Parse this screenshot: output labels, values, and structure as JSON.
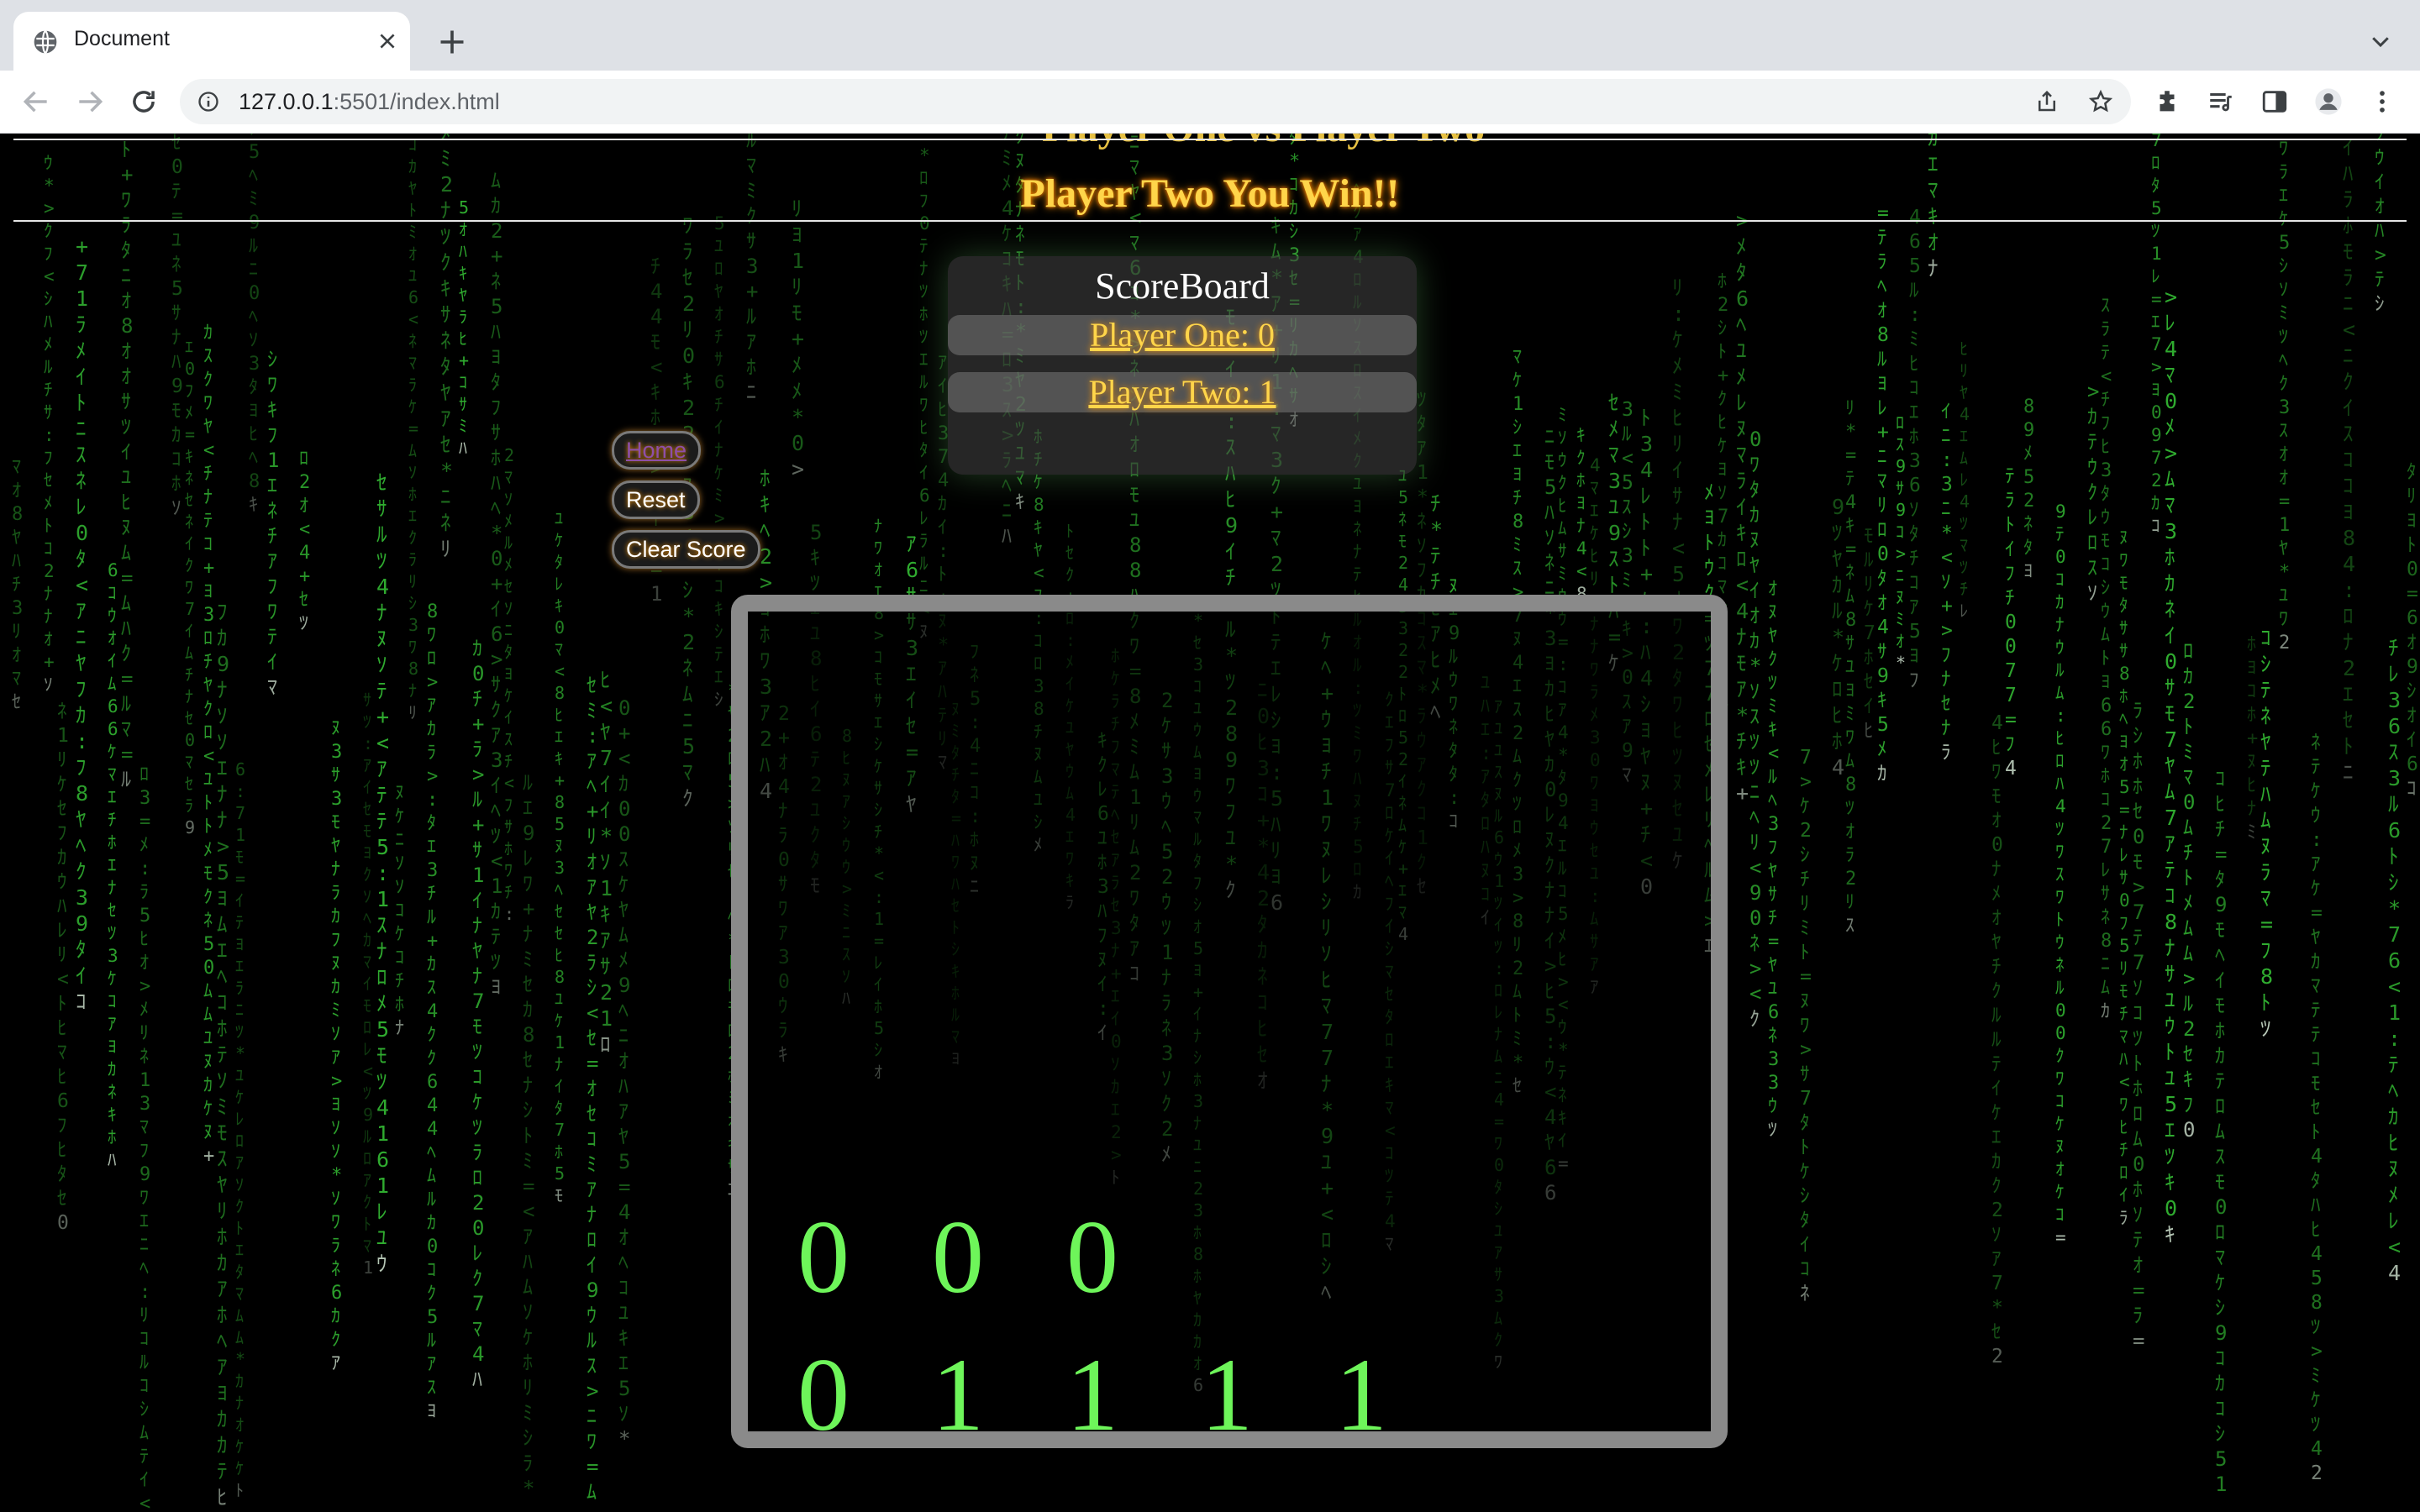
{
  "browser": {
    "tab_title": "Document",
    "url_host": "127.0.0.1",
    "url_path": ":5501/index.html"
  },
  "page": {
    "partial_title": "Player One vs Player Two",
    "winner_text": "Player Two You Win!!",
    "scoreboard": {
      "title": "ScoreBoard",
      "player_one": "Player One: 0",
      "player_two": "Player Two: 1"
    },
    "buttons": {
      "home": "Home",
      "reset": "Reset",
      "clear_score": "Clear Score"
    },
    "board": {
      "row1": [
        "0",
        "0",
        "0"
      ],
      "row2": [
        "0",
        "1",
        "1",
        "1",
        "1"
      ]
    },
    "colors": {
      "rain": "#3ddc3d",
      "cell": "#6ef55a",
      "accent": "#ffd54a"
    }
  }
}
